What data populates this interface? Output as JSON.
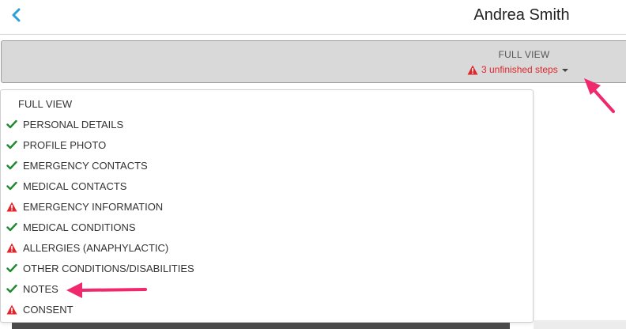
{
  "header": {
    "title": "Andrea Smith",
    "back_icon": "chevron-left-icon"
  },
  "view_bar": {
    "label": "FULL VIEW",
    "unfinished_text": "3 unfinished steps",
    "warning_icon": "warning-icon",
    "caret_icon": "caret-down-icon"
  },
  "menu": {
    "items": [
      {
        "label": "FULL VIEW",
        "status": "none"
      },
      {
        "label": "PERSONAL DETAILS",
        "status": "complete"
      },
      {
        "label": "PROFILE PHOTO",
        "status": "complete"
      },
      {
        "label": "EMERGENCY CONTACTS",
        "status": "complete"
      },
      {
        "label": "MEDICAL CONTACTS",
        "status": "complete"
      },
      {
        "label": "EMERGENCY INFORMATION",
        "status": "warning"
      },
      {
        "label": "MEDICAL CONDITIONS",
        "status": "complete"
      },
      {
        "label": "ALLERGIES (ANAPHYLACTIC)",
        "status": "warning"
      },
      {
        "label": "OTHER CONDITIONS/DISABILITIES",
        "status": "complete"
      },
      {
        "label": "NOTES",
        "status": "complete"
      },
      {
        "label": "CONSENT",
        "status": "warning"
      }
    ]
  },
  "colors": {
    "accent_blue": "#2a9fd8",
    "check_green": "#1e8a2e",
    "warning_red": "#e0262b",
    "annotation_pink": "#f0286e"
  }
}
